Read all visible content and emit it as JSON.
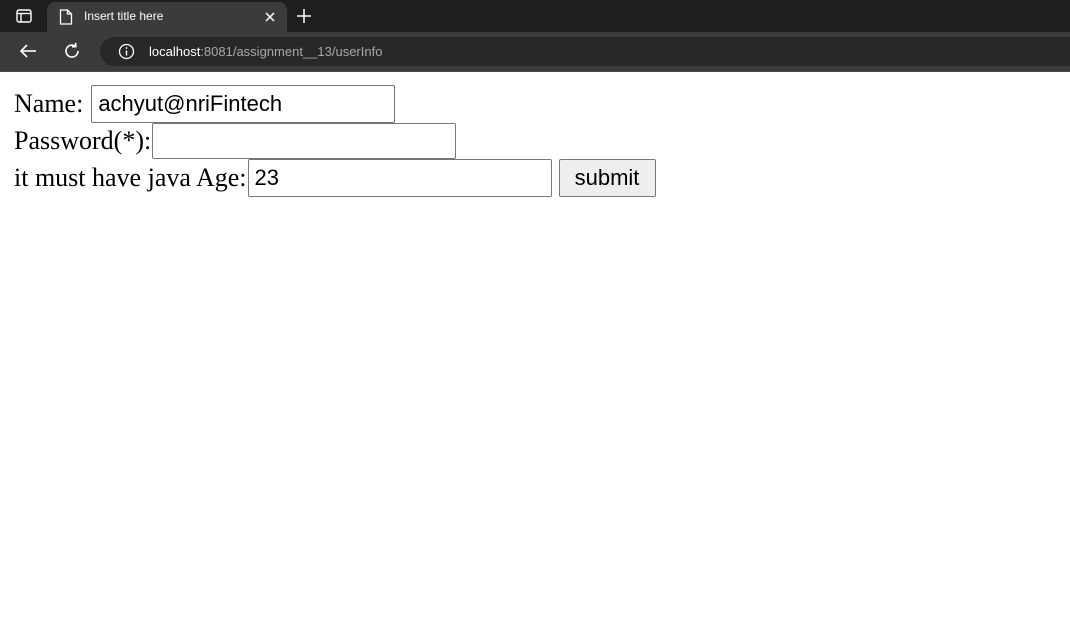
{
  "browser": {
    "tab": {
      "title": "Insert title here"
    },
    "address_bar": {
      "host": "localhost",
      "path": ":8081/assignment__13/userInfo"
    },
    "icons": {
      "tab_actions": "tab-actions-icon",
      "favicon": "page-icon",
      "close": "close-icon",
      "new_tab": "plus-icon",
      "back": "back-arrow-icon",
      "reload": "reload-icon",
      "site_info": "info-icon"
    }
  },
  "form": {
    "name_label": "Name:",
    "name_value": "achyut@nriFintech",
    "password_label": "Password(*):",
    "password_value": "",
    "age_label_prefix": "it must have java Age:",
    "age_value": "23",
    "submit_label": "submit"
  },
  "colors": {
    "tabstrip_bg": "#1f1f1f",
    "toolbar_bg": "#3b3b3b",
    "omnibox_bg": "#282828",
    "page_bg": "#ffffff"
  }
}
